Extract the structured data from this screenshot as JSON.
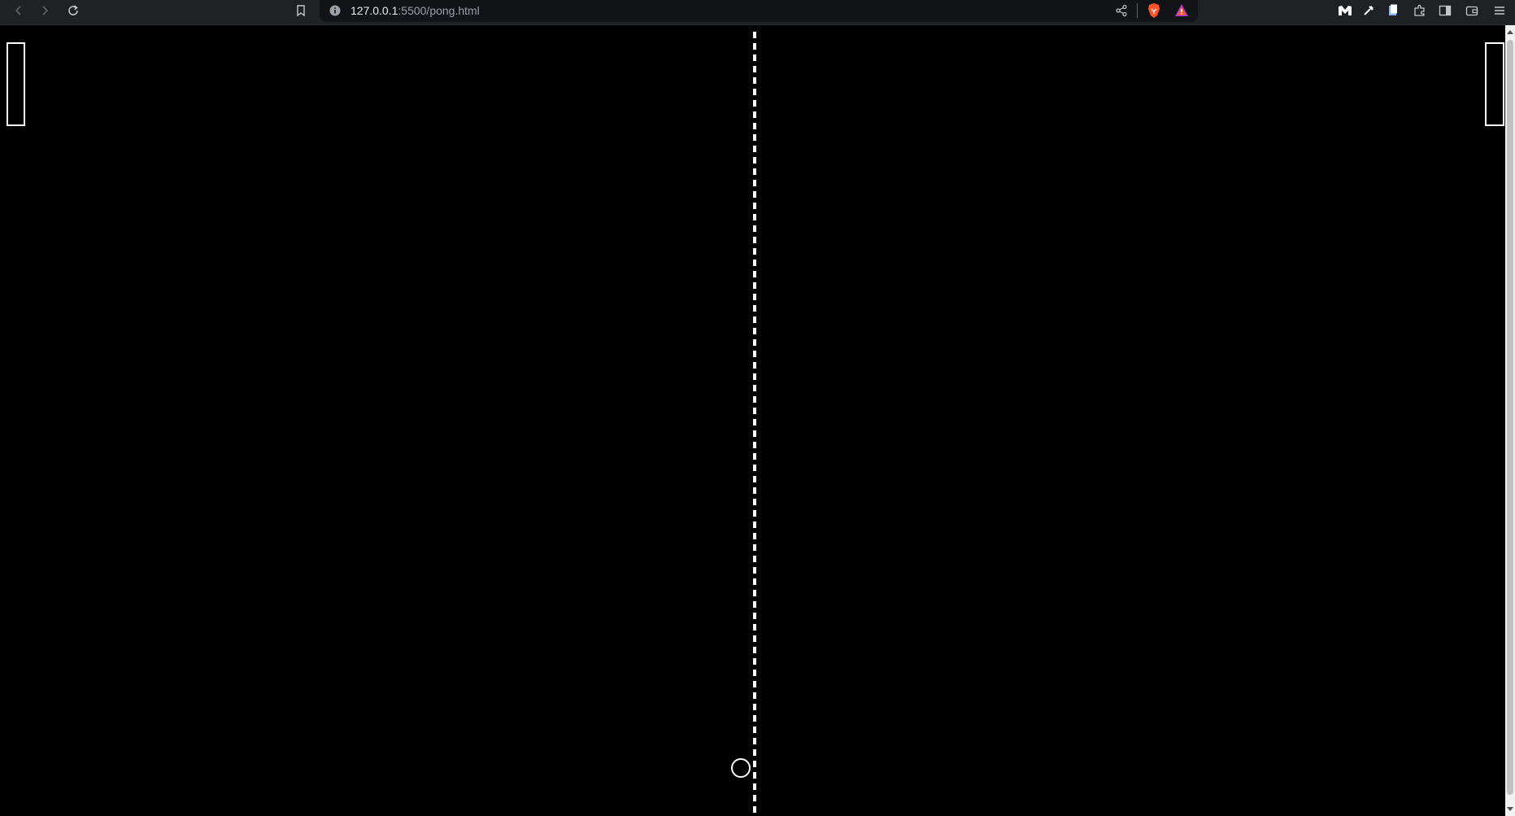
{
  "browser": {
    "url_host": "127.0.0.1",
    "url_path": ":5500/pong.html",
    "toolbar_icons": {
      "back": "back-arrow-icon",
      "forward": "forward-arrow-icon",
      "reload": "reload-icon",
      "bookmark": "bookmark-icon",
      "site_info": "info-icon",
      "share": "share-icon",
      "brave_shields": "brave-lion-icon",
      "brave_rewards": "rewards-triangle-icon",
      "extension_1": "m-logo-icon",
      "extension_2": "eyedropper-icon",
      "extension_3": "document-icon",
      "extensions": "puzzle-icon",
      "sidebar": "sidebar-icon",
      "wallet": "wallet-icon",
      "menu": "hamburger-menu-icon"
    }
  },
  "game": {
    "background_color": "#000000",
    "line_color": "#ffffff"
  }
}
